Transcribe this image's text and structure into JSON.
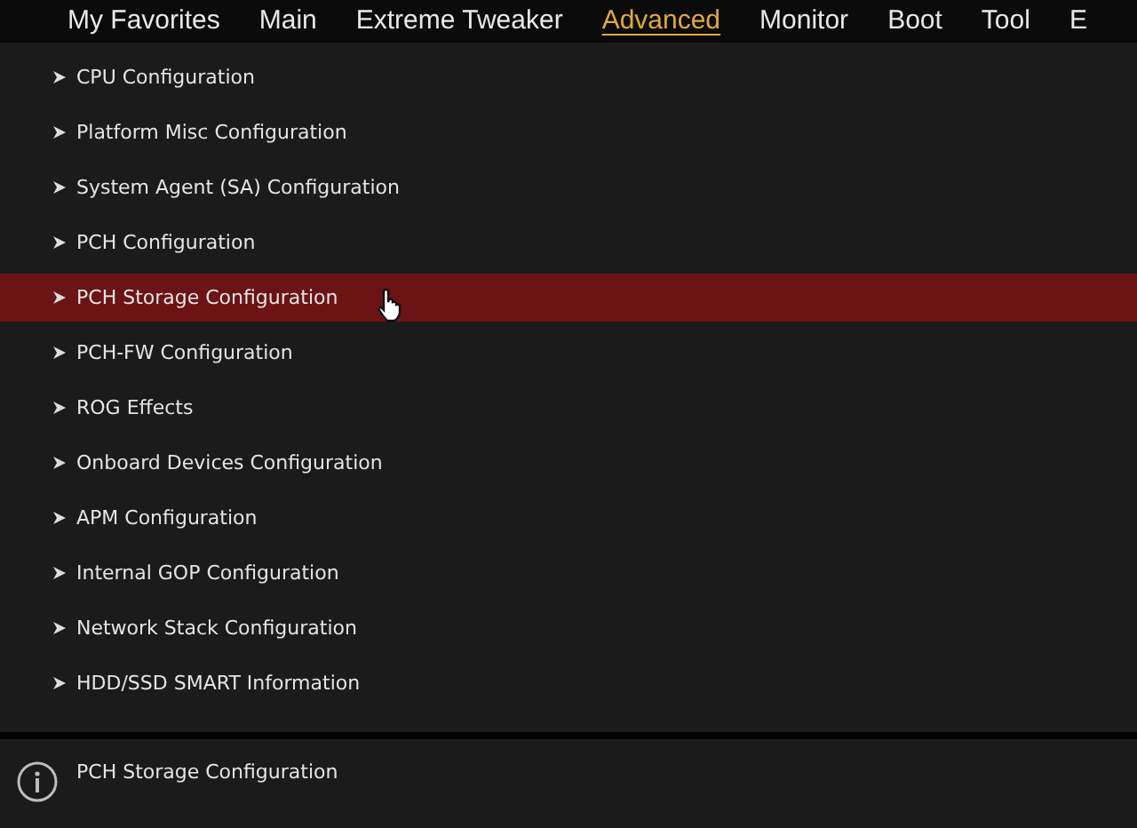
{
  "tabs": [
    {
      "label": "My Favorites",
      "selected": false
    },
    {
      "label": "Main",
      "selected": false
    },
    {
      "label": "Extreme Tweaker",
      "selected": false
    },
    {
      "label": "Advanced",
      "selected": true
    },
    {
      "label": "Monitor",
      "selected": false
    },
    {
      "label": "Boot",
      "selected": false
    },
    {
      "label": "Tool",
      "selected": false
    },
    {
      "label": "E",
      "selected": false
    }
  ],
  "menu_items": [
    {
      "label": "CPU Configuration",
      "selected": false
    },
    {
      "label": "Platform Misc Configuration",
      "selected": false
    },
    {
      "label": "System Agent (SA) Configuration",
      "selected": false
    },
    {
      "label": "PCH Configuration",
      "selected": false
    },
    {
      "label": "PCH Storage Configuration",
      "selected": true
    },
    {
      "label": "PCH-FW Configuration",
      "selected": false
    },
    {
      "label": "ROG Effects",
      "selected": false
    },
    {
      "label": "Onboard Devices Configuration",
      "selected": false
    },
    {
      "label": "APM Configuration",
      "selected": false
    },
    {
      "label": "Internal GOP Configuration",
      "selected": false
    },
    {
      "label": "Network Stack Configuration",
      "selected": false
    },
    {
      "label": "HDD/SSD SMART Information",
      "selected": false
    }
  ],
  "help_text": "PCH Storage Configuration"
}
